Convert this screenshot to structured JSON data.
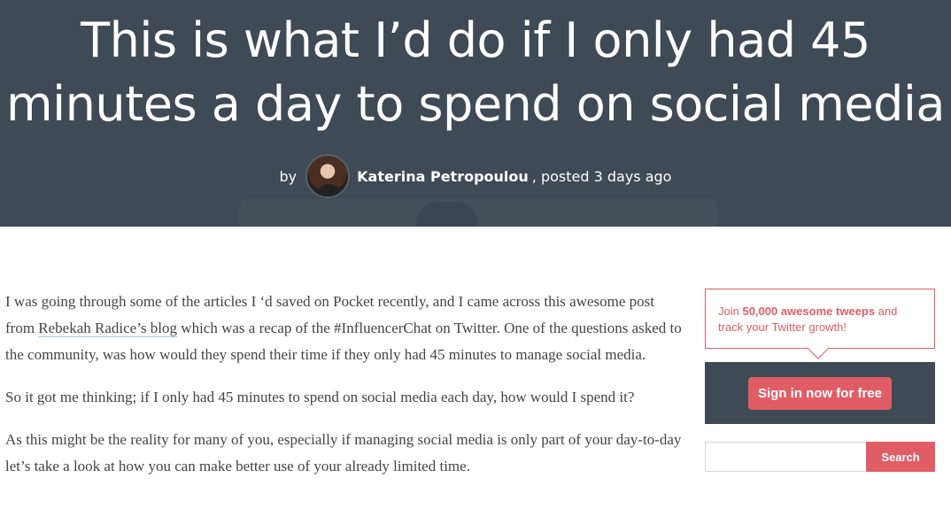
{
  "hero": {
    "title": "This is what I’d do if I only had 45 minutes a day to spend on social media",
    "by_label": "by",
    "author": "Katerina Petropoulou",
    "posted": ", posted 3 days ago"
  },
  "article": {
    "p1_before": "I was going through some of the articles I ‘d saved on Pocket recently, and I came across this awesome post from ",
    "p1_link": "Rebekah Radice’s blog",
    "p1_after": " which was a recap of the #InfluencerChat on Twitter. One of the questions asked to the community, was how would they spend their time if they only had 45 minutes to manage social media.",
    "p2": "So it got me thinking; if I only had 45 minutes to spend on social media each day, how would I spend it?",
    "p3": "As this might be the reality for many of you, especially if managing social media is only part of your day-to-day let’s take a look at how you can make better use of your already limited time."
  },
  "sidebar": {
    "promo_join": "Join ",
    "promo_highlight": "50,000 awesome tweeps",
    "promo_rest": " and track your Twitter growth!",
    "signin_label": "Sign in now for free",
    "search_placeholder": "",
    "search_label": "Search"
  },
  "colors": {
    "hero_bg": "#3e4a55",
    "accent": "#e05d65",
    "text": "#444444"
  }
}
